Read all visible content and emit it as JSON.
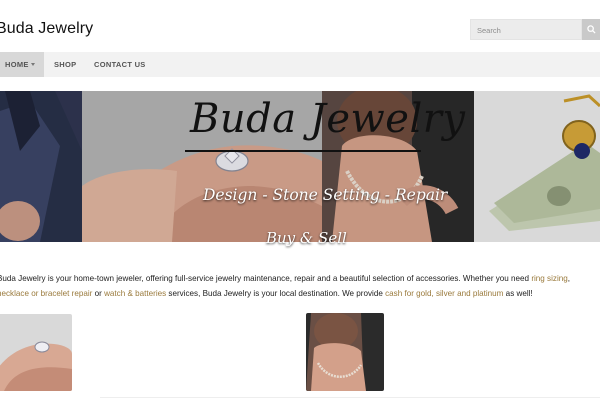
{
  "header": {
    "site_title": "Buda Jewelry"
  },
  "search": {
    "placeholder": "Search",
    "icon": "search-icon"
  },
  "nav": {
    "items": [
      {
        "label": "HOME",
        "has_dropdown": true,
        "active": true
      },
      {
        "label": "SHOP"
      },
      {
        "label": "CONTACT US"
      }
    ]
  },
  "hero": {
    "title": "Buda Jewelry",
    "subtitle": "Design - Stone Setting - Repair",
    "tagline": "Buy & Sell"
  },
  "intro": {
    "text_1": "Buda Jewelry is your home-town jeweler, offering full-service jewelry maintenance, repair and a beautiful selection of accessories. Whether you need ",
    "link_ring_sizing": "ring sizing",
    "text_2": ", ",
    "link_necklace_bracelet": "necklace or bracelet repair",
    "text_3": " or ",
    "link_watch": "watch & batteries",
    "text_4": " services, Buda Jewelry is your local destination. We provide ",
    "link_cash": "cash for gold, silver and platinum",
    "text_5": " as well!"
  },
  "colors": {
    "link": "#9a7a3c",
    "nav_background": "#f2f2f2",
    "nav_active_background": "#d8d8d8"
  }
}
